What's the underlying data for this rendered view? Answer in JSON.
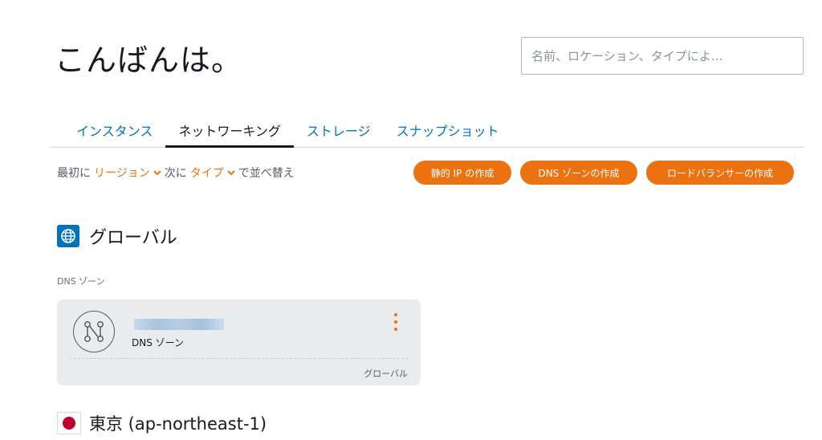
{
  "greeting": "こんばんは。",
  "search": {
    "placeholder": "名前、ロケーション、タイプによ..."
  },
  "tabs": [
    {
      "label": "インスタンス",
      "active": false
    },
    {
      "label": "ネットワーキング",
      "active": true
    },
    {
      "label": "ストレージ",
      "active": false
    },
    {
      "label": "スナップショット",
      "active": false
    }
  ],
  "sort": {
    "prefix": "最初に",
    "first": "リージョン",
    "middle": "次に",
    "second": "タイプ",
    "suffix": "で並べ替え"
  },
  "actions": {
    "create_static_ip": "静的 IP の作成",
    "create_dns_zone": "DNS ゾーンの作成",
    "create_load_balancer": "ロードバランサーの作成"
  },
  "regions": {
    "global": {
      "title": "グローバル",
      "icon": "globe-icon"
    },
    "tokyo": {
      "title": "東京 (ap-northeast-1)",
      "icon": "japan-flag-icon"
    }
  },
  "section": {
    "dns_zones_label": "DNS ゾーン"
  },
  "card": {
    "type": "DNS ゾーン",
    "region": "グローバル",
    "icon": "dns-zone-icon"
  },
  "colors": {
    "accent": "#ec7211",
    "link": "#0073bb",
    "card_bg": "#e9ebed",
    "flag_red": "#bc002d"
  }
}
